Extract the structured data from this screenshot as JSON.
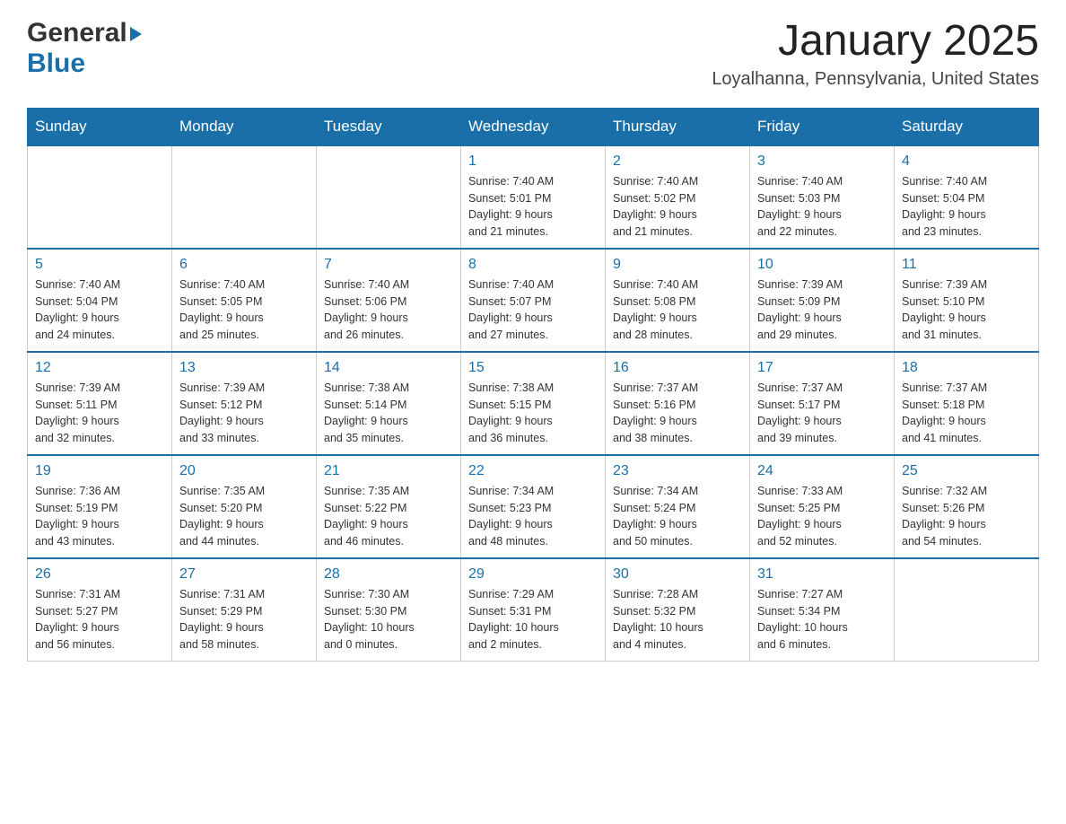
{
  "header": {
    "logo_general": "General",
    "logo_blue": "Blue",
    "month_title": "January 2025",
    "location": "Loyalhanna, Pennsylvania, United States"
  },
  "calendar": {
    "days_of_week": [
      "Sunday",
      "Monday",
      "Tuesday",
      "Wednesday",
      "Thursday",
      "Friday",
      "Saturday"
    ],
    "weeks": [
      [
        {
          "day": "",
          "info": ""
        },
        {
          "day": "",
          "info": ""
        },
        {
          "day": "",
          "info": ""
        },
        {
          "day": "1",
          "info": "Sunrise: 7:40 AM\nSunset: 5:01 PM\nDaylight: 9 hours\nand 21 minutes."
        },
        {
          "day": "2",
          "info": "Sunrise: 7:40 AM\nSunset: 5:02 PM\nDaylight: 9 hours\nand 21 minutes."
        },
        {
          "day": "3",
          "info": "Sunrise: 7:40 AM\nSunset: 5:03 PM\nDaylight: 9 hours\nand 22 minutes."
        },
        {
          "day": "4",
          "info": "Sunrise: 7:40 AM\nSunset: 5:04 PM\nDaylight: 9 hours\nand 23 minutes."
        }
      ],
      [
        {
          "day": "5",
          "info": "Sunrise: 7:40 AM\nSunset: 5:04 PM\nDaylight: 9 hours\nand 24 minutes."
        },
        {
          "day": "6",
          "info": "Sunrise: 7:40 AM\nSunset: 5:05 PM\nDaylight: 9 hours\nand 25 minutes."
        },
        {
          "day": "7",
          "info": "Sunrise: 7:40 AM\nSunset: 5:06 PM\nDaylight: 9 hours\nand 26 minutes."
        },
        {
          "day": "8",
          "info": "Sunrise: 7:40 AM\nSunset: 5:07 PM\nDaylight: 9 hours\nand 27 minutes."
        },
        {
          "day": "9",
          "info": "Sunrise: 7:40 AM\nSunset: 5:08 PM\nDaylight: 9 hours\nand 28 minutes."
        },
        {
          "day": "10",
          "info": "Sunrise: 7:39 AM\nSunset: 5:09 PM\nDaylight: 9 hours\nand 29 minutes."
        },
        {
          "day": "11",
          "info": "Sunrise: 7:39 AM\nSunset: 5:10 PM\nDaylight: 9 hours\nand 31 minutes."
        }
      ],
      [
        {
          "day": "12",
          "info": "Sunrise: 7:39 AM\nSunset: 5:11 PM\nDaylight: 9 hours\nand 32 minutes."
        },
        {
          "day": "13",
          "info": "Sunrise: 7:39 AM\nSunset: 5:12 PM\nDaylight: 9 hours\nand 33 minutes."
        },
        {
          "day": "14",
          "info": "Sunrise: 7:38 AM\nSunset: 5:14 PM\nDaylight: 9 hours\nand 35 minutes."
        },
        {
          "day": "15",
          "info": "Sunrise: 7:38 AM\nSunset: 5:15 PM\nDaylight: 9 hours\nand 36 minutes."
        },
        {
          "day": "16",
          "info": "Sunrise: 7:37 AM\nSunset: 5:16 PM\nDaylight: 9 hours\nand 38 minutes."
        },
        {
          "day": "17",
          "info": "Sunrise: 7:37 AM\nSunset: 5:17 PM\nDaylight: 9 hours\nand 39 minutes."
        },
        {
          "day": "18",
          "info": "Sunrise: 7:37 AM\nSunset: 5:18 PM\nDaylight: 9 hours\nand 41 minutes."
        }
      ],
      [
        {
          "day": "19",
          "info": "Sunrise: 7:36 AM\nSunset: 5:19 PM\nDaylight: 9 hours\nand 43 minutes."
        },
        {
          "day": "20",
          "info": "Sunrise: 7:35 AM\nSunset: 5:20 PM\nDaylight: 9 hours\nand 44 minutes."
        },
        {
          "day": "21",
          "info": "Sunrise: 7:35 AM\nSunset: 5:22 PM\nDaylight: 9 hours\nand 46 minutes."
        },
        {
          "day": "22",
          "info": "Sunrise: 7:34 AM\nSunset: 5:23 PM\nDaylight: 9 hours\nand 48 minutes."
        },
        {
          "day": "23",
          "info": "Sunrise: 7:34 AM\nSunset: 5:24 PM\nDaylight: 9 hours\nand 50 minutes."
        },
        {
          "day": "24",
          "info": "Sunrise: 7:33 AM\nSunset: 5:25 PM\nDaylight: 9 hours\nand 52 minutes."
        },
        {
          "day": "25",
          "info": "Sunrise: 7:32 AM\nSunset: 5:26 PM\nDaylight: 9 hours\nand 54 minutes."
        }
      ],
      [
        {
          "day": "26",
          "info": "Sunrise: 7:31 AM\nSunset: 5:27 PM\nDaylight: 9 hours\nand 56 minutes."
        },
        {
          "day": "27",
          "info": "Sunrise: 7:31 AM\nSunset: 5:29 PM\nDaylight: 9 hours\nand 58 minutes."
        },
        {
          "day": "28",
          "info": "Sunrise: 7:30 AM\nSunset: 5:30 PM\nDaylight: 10 hours\nand 0 minutes."
        },
        {
          "day": "29",
          "info": "Sunrise: 7:29 AM\nSunset: 5:31 PM\nDaylight: 10 hours\nand 2 minutes."
        },
        {
          "day": "30",
          "info": "Sunrise: 7:28 AM\nSunset: 5:32 PM\nDaylight: 10 hours\nand 4 minutes."
        },
        {
          "day": "31",
          "info": "Sunrise: 7:27 AM\nSunset: 5:34 PM\nDaylight: 10 hours\nand 6 minutes."
        },
        {
          "day": "",
          "info": ""
        }
      ]
    ]
  }
}
